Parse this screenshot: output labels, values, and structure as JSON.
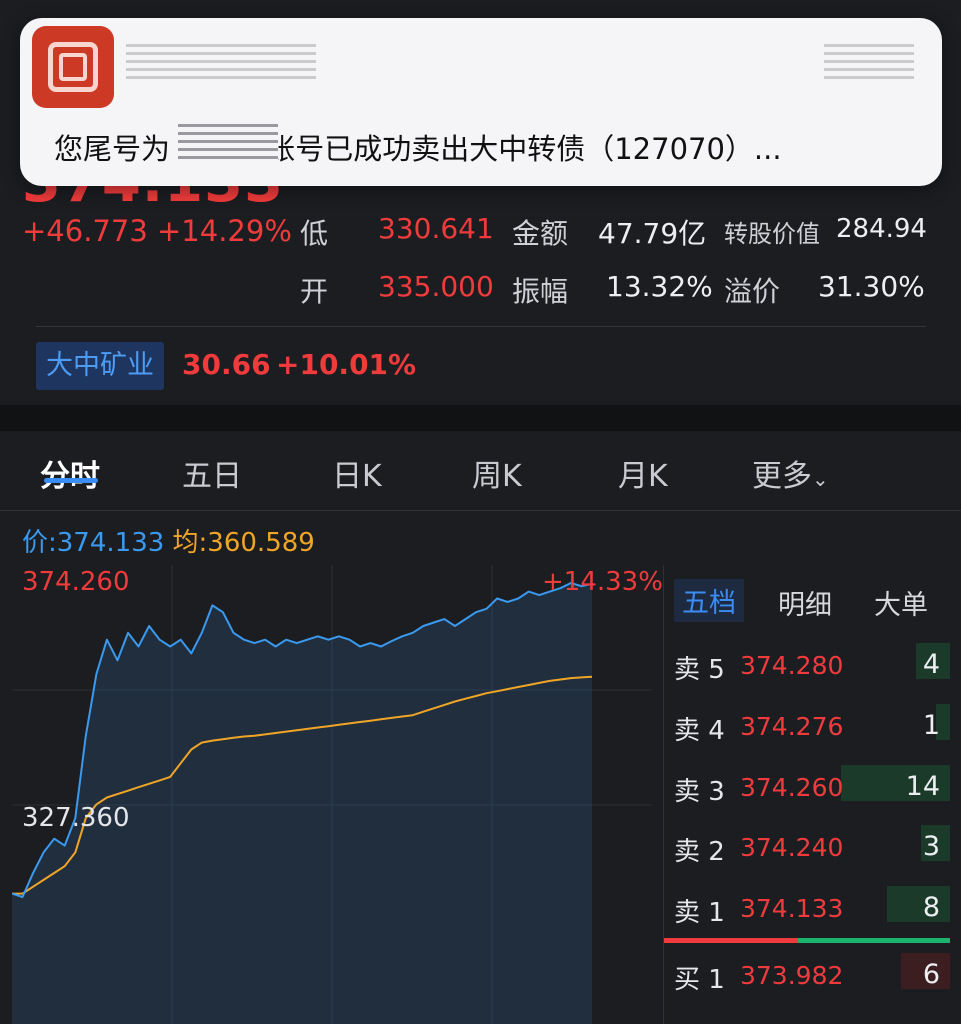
{
  "notification": {
    "app_icon": "bank-app-icon",
    "message": "您尾号为  的资金账号已成功卖出大中转债（127070）..."
  },
  "quote": {
    "price": "374.133",
    "change": "+46.773",
    "change_pct": "+14.29%",
    "low_label": "低",
    "low_value": "330.641",
    "amount_label": "金额",
    "amount_value": "47.79亿",
    "conv_value_label": "转股价值",
    "conv_value": "284.94",
    "open_label": "开",
    "open_value": "335.000",
    "amplitude_label": "振幅",
    "amplitude_value": "13.32%",
    "premium_label": "溢价",
    "premium_value": "31.30%"
  },
  "underlying": {
    "name": "大中矿业",
    "price": "30.66",
    "change_pct": "+10.01%"
  },
  "tabs": [
    "分时",
    "五日",
    "日K",
    "周K",
    "月K",
    "更多"
  ],
  "tabs_more_icon": "chevron-down-icon",
  "legend": {
    "price_text": "价:374.133",
    "avg_text": "均:360.589"
  },
  "chart_labels": {
    "high": "374.260",
    "low": "327.360",
    "high_pct": "+14.33%"
  },
  "colors": {
    "up": "#ef3b3b",
    "down": "#1bb36d",
    "price_line": "#3a9af0",
    "avg_line": "#f0a526",
    "accent": "#3a8df5"
  },
  "book": {
    "tabs": [
      "五档",
      "明细",
      "大单"
    ],
    "rows": [
      {
        "side": "卖 5",
        "price": "374.280",
        "qty": "4",
        "bar": 0.12,
        "color": "#1b3a2a"
      },
      {
        "side": "卖 4",
        "price": "374.276",
        "qty": "1",
        "bar": 0.05,
        "color": "#1b3a2a"
      },
      {
        "side": "卖 3",
        "price": "374.260",
        "qty": "14",
        "bar": 0.38,
        "color": "#1b3a2a"
      },
      {
        "side": "卖 2",
        "price": "374.240",
        "qty": "3",
        "bar": 0.1,
        "color": "#1b3a2a"
      },
      {
        "side": "卖 1",
        "price": "374.133",
        "qty": "8",
        "bar": 0.22,
        "color": "#1b3a2a"
      },
      {
        "side": "买 1",
        "price": "373.982",
        "qty": "6",
        "bar": 0.17,
        "color": "#3d1e20"
      }
    ]
  },
  "chart_data": {
    "type": "line",
    "series": [
      {
        "values": [
          329,
          328.5,
          332,
          335,
          337,
          336,
          340,
          352,
          361,
          366,
          363,
          367,
          365,
          368,
          366,
          365,
          366,
          364,
          367,
          371,
          370,
          367,
          366,
          365.5,
          366,
          365,
          366,
          365.5,
          366,
          366.5,
          366,
          366.5,
          366,
          365,
          365.5,
          365,
          365.8,
          366.5,
          367,
          368,
          368.5,
          369,
          368,
          369,
          370,
          370.5,
          372,
          371.5,
          372,
          373,
          372.5,
          373,
          373.5,
          374.26,
          373.8,
          374.133
        ]
      },
      {
        "values": [
          329,
          329,
          330,
          331,
          332,
          333,
          335,
          340,
          342,
          343,
          343.5,
          344,
          344.5,
          345,
          345.5,
          346,
          348,
          350,
          351,
          351.3,
          351.5,
          351.7,
          351.9,
          352,
          352.2,
          352.4,
          352.6,
          352.8,
          353,
          353.2,
          353.4,
          353.6,
          353.8,
          354,
          354.2,
          354.4,
          354.6,
          354.8,
          355,
          355.5,
          356,
          356.5,
          357,
          357.4,
          357.8,
          358.2,
          358.5,
          358.8,
          359.1,
          359.4,
          359.7,
          360,
          360.2,
          360.4,
          360.5,
          360.589
        ]
      }
    ],
    "ylim": [
      310,
      374.26
    ],
    "grid": true
  }
}
